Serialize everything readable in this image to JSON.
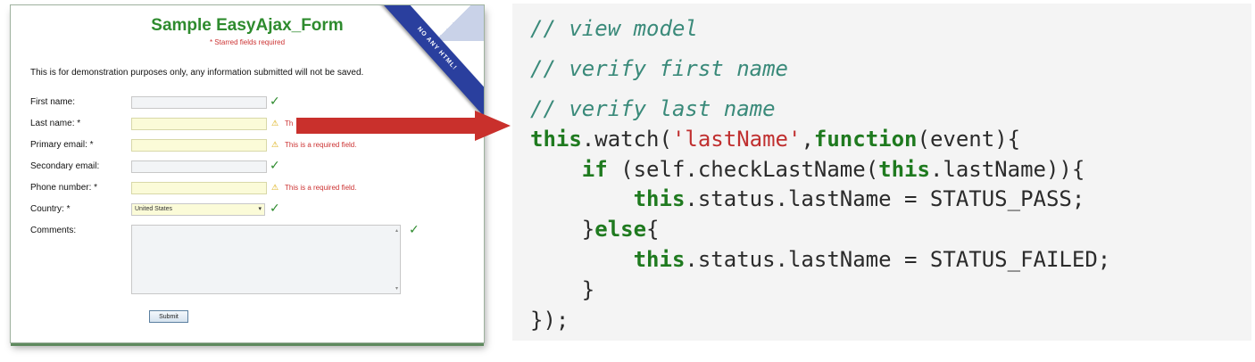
{
  "form": {
    "title": "Sample EasyAjax_Form",
    "subtitle": "* Starred fields required",
    "ribbon_text": "NO ANY HTML!",
    "disclaimer": "This is for demonstration purposes only, any information submitted will not be saved.",
    "fields": [
      {
        "label": "First name:",
        "status": "pass",
        "message": ""
      },
      {
        "label": "Last name: *",
        "status": "warning",
        "message": "Th"
      },
      {
        "label": "Primary email: *",
        "status": "warning",
        "message": "This is a required field."
      },
      {
        "label": "Secondary email:",
        "status": "pass",
        "message": ""
      },
      {
        "label": "Phone number: *",
        "status": "warning",
        "message": "This is a required field."
      }
    ],
    "country": {
      "label": "Country: *",
      "value": "United States"
    },
    "comments": {
      "label": "Comments:"
    },
    "submit_label": "Submit",
    "check_glyph": "✓",
    "warn_glyph": "⚠"
  },
  "code": {
    "lines": [
      "// view model",
      "// verify first name",
      "// verify last name",
      "this.watch('lastName',function(event){",
      "    if (self.checkLastName(this.lastName)){",
      "        this.status.lastName = STATUS_PASS;",
      "    }else{",
      "        this.status.lastName = STATUS_FAILED;",
      "    }",
      "});"
    ]
  },
  "colors": {
    "title_green": "#2e8b2e",
    "required_red": "#cc3333",
    "arrow_red": "#c9302c",
    "keyword_green": "#1f7a1f",
    "comment_teal": "#3a8a7a",
    "string_red": "#c03030"
  }
}
